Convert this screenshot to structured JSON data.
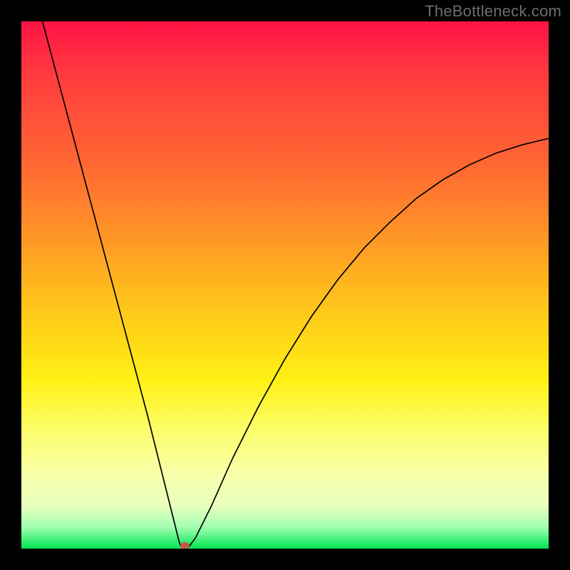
{
  "watermark": "TheBottleneck.com",
  "chart_data": {
    "type": "line",
    "title": "",
    "xlabel": "",
    "ylabel": "",
    "xlim": [
      0,
      100
    ],
    "ylim": [
      0,
      100
    ],
    "series": [
      {
        "name": "curve",
        "x": [
          4,
          8,
          12,
          16,
          20,
          24,
          27,
          29,
          30,
          30.5,
          31.5,
          33,
          36,
          40,
          45,
          50,
          55,
          60,
          65,
          70,
          75,
          80,
          85,
          90,
          95,
          100
        ],
        "y": [
          100,
          85,
          70,
          55,
          40,
          25,
          13,
          5,
          1,
          0,
          0,
          2,
          8,
          17,
          27,
          36,
          44,
          51,
          57,
          62,
          66.5,
          70,
          72.8,
          75,
          76.6,
          77.8
        ]
      }
    ],
    "marker": {
      "x": 31,
      "y": 0.5
    },
    "gradient_stops": [
      {
        "pos": 0,
        "color": "#ff1345"
      },
      {
        "pos": 28,
        "color": "#ff6a32"
      },
      {
        "pos": 55,
        "color": "#ffc91a"
      },
      {
        "pos": 78,
        "color": "#fcff6f"
      },
      {
        "pos": 100,
        "color": "#00e551"
      }
    ]
  }
}
